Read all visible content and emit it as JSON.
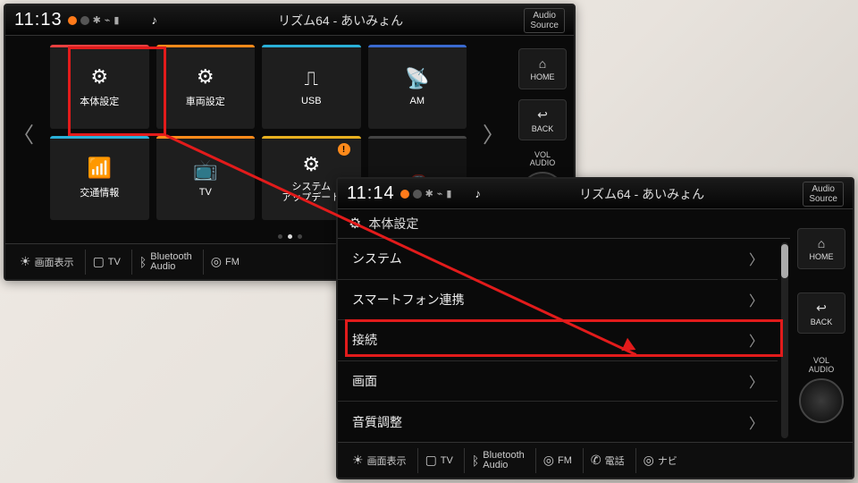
{
  "screen1": {
    "clock": "11:13",
    "nowplaying": "リズム64 - あいみょん",
    "audio_source_label": "Audio\nSource",
    "tiles": [
      {
        "label": "本体設定",
        "icon": "⚙",
        "color": "red"
      },
      {
        "label": "車両設定",
        "icon": "⚙",
        "color": "orange"
      },
      {
        "label": "USB",
        "icon": "⎍",
        "color": "cyan"
      },
      {
        "label": "AM",
        "icon": "📡",
        "color": "blue"
      },
      {
        "label": "交通情報",
        "icon": "📶",
        "color": "cyan"
      },
      {
        "label": "TV",
        "icon": "📺",
        "color": "orange"
      },
      {
        "label": "システム\nアップデート",
        "icon": "⚙",
        "color": "yellow",
        "badge": "!"
      },
      {
        "label": "",
        "icon": "🚗",
        "color": "grey"
      }
    ],
    "side": {
      "home": "HOME",
      "back": "BACK",
      "vol": "VOL\nAUDIO"
    },
    "bottom": {
      "disp": "画面表示",
      "tv": "TV",
      "btaudio": "Bluetooth\nAudio",
      "fm": "FM"
    }
  },
  "screen2": {
    "clock": "11:14",
    "nowplaying": "リズム64 - あいみょん",
    "audio_source_label": "Audio\nSource",
    "header": "本体設定",
    "rows": [
      "システム",
      "スマートフォン連携",
      "接続",
      "画面",
      "音質調整"
    ],
    "side": {
      "home": "HOME",
      "back": "BACK",
      "vol": "VOL\nAUDIO"
    },
    "bottom": {
      "disp": "画面表示",
      "tv": "TV",
      "btaudio": "Bluetooth\nAudio",
      "fm": "FM",
      "phone": "電話",
      "navi": "ナビ"
    }
  }
}
